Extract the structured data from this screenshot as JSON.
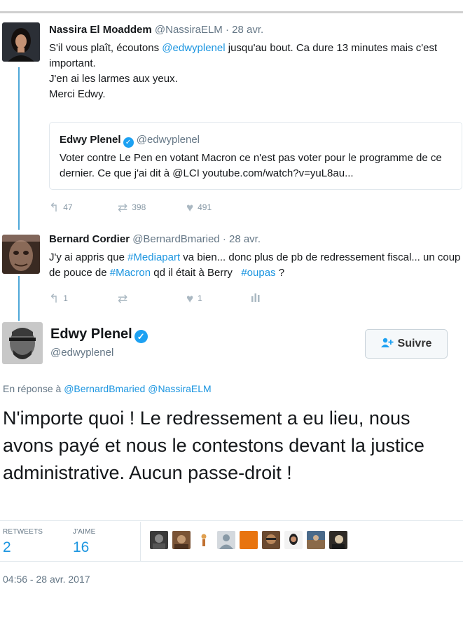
{
  "thread": [
    {
      "name": "Nassira El Moaddem",
      "handle": "@NassiraELM",
      "time": "· 28 avr.",
      "text": {
        "p1_before": "S'il vous plaît, écoutons ",
        "p1_link": "@edwyplenel",
        "p1_after": " jusqu'au bout. Ca dure 13 minutes mais c'est important.",
        "p2": "J'en ai les larmes aux yeux.",
        "p3": "Merci Edwy."
      },
      "quote": {
        "name": "Edwy Plenel",
        "handle": "@edwyplenel",
        "text": "Voter contre Le Pen en votant Macron ce n'est pas voter pour le programme de ce dernier. Ce que j'ai dit à @LCI youtube.com/watch?v=yuL8au..."
      },
      "actions": {
        "replies": "47",
        "retweets": "398",
        "likes": "491"
      }
    },
    {
      "name": "Bernard Cordier",
      "handle": "@BernardBmaried",
      "time": "· 28 avr.",
      "text": {
        "s1": "J'y ai appris que ",
        "l1": "#Mediapart",
        "s2": " va bien... donc plus de pb de redressement fiscal... un coup de pouce de ",
        "l2": "#Macron",
        "s3": " qd il était à Berry   ",
        "l3": "#oupas",
        "s4": " ?"
      },
      "actions": {
        "replies": "1",
        "retweets": "",
        "likes": "1"
      }
    }
  ],
  "main_tweet": {
    "name": "Edwy Plenel",
    "handle": "@edwyplenel",
    "follow_label": "Suivre",
    "reply_prefix": "En réponse à",
    "reply_mention_1": "@BernardBmaried",
    "reply_mention_2": "@NassiraELM",
    "text": "N'importe quoi ! Le redressement a eu lieu, nous avons payé et nous le contestons devant la justice administrative. Aucun passe-droit !",
    "retweets_label": "RETWEETS",
    "retweets_count": "2",
    "likes_label": "J'AIME",
    "likes_count": "16",
    "timestamp": "04:56 - 28 avr. 2017"
  },
  "icons": {
    "reply": "reply-icon",
    "retweet": "retweet-icon",
    "like": "heart-icon",
    "analytics": "analytics-icon",
    "verified": "verified-badge-icon",
    "follow": "follow-user-icon"
  },
  "colors": {
    "link": "#1b95e0",
    "thread_line": "#4ea7d8",
    "verified": "#1da1f2"
  }
}
